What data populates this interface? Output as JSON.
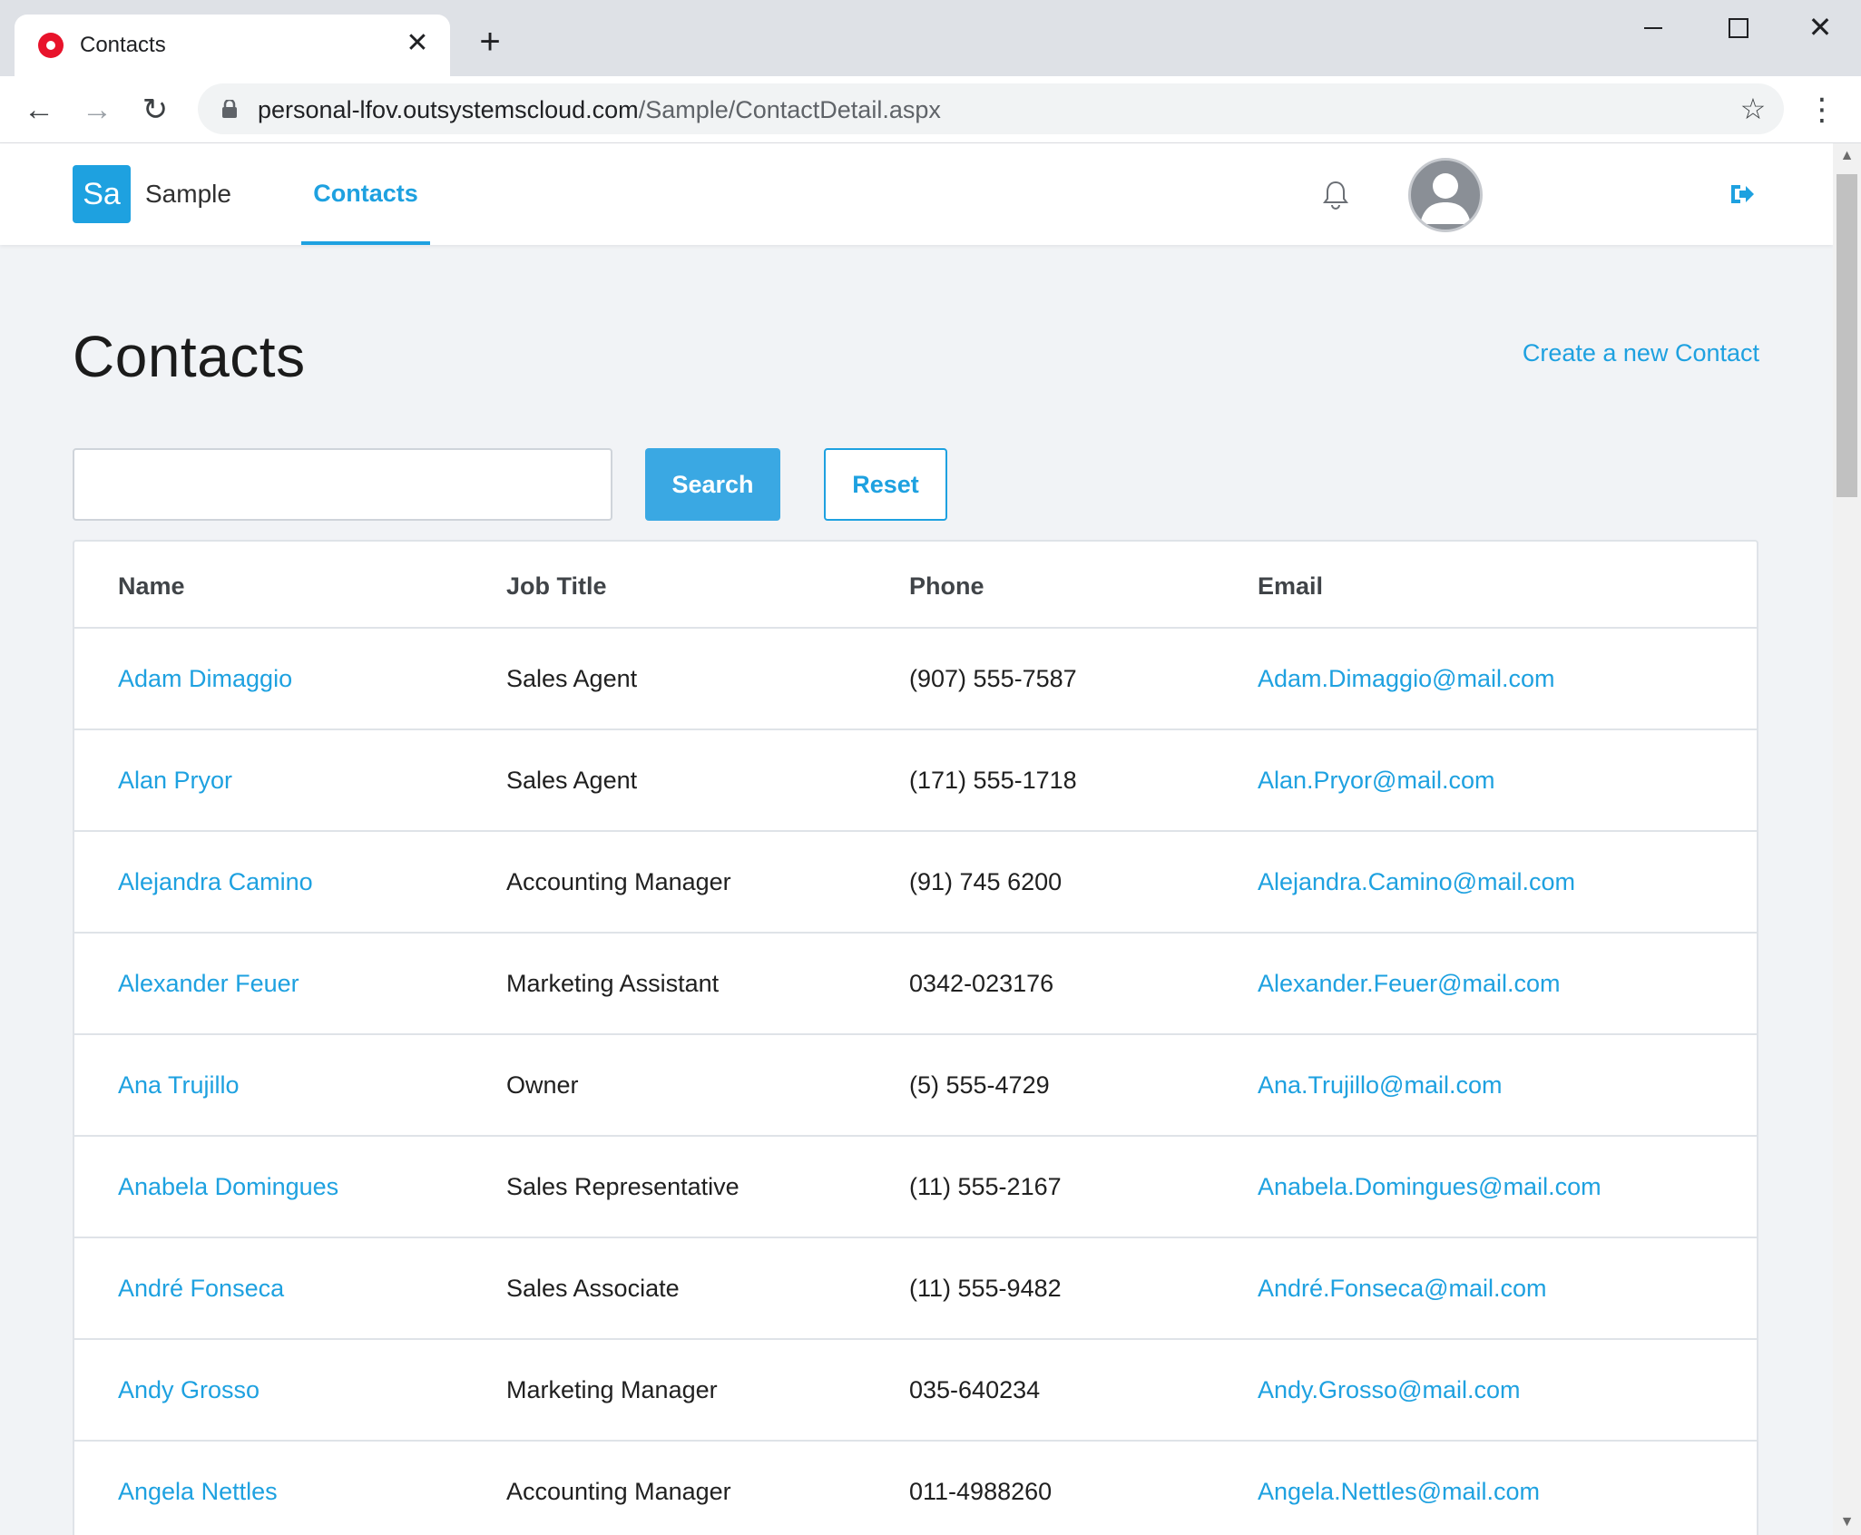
{
  "browser": {
    "tab_title": "Contacts",
    "tab_close": "✕",
    "new_tab": "+",
    "url_host": "personal-lfov.outsystemscloud.com",
    "url_path": "/Sample/ContactDetail.aspx",
    "icons": {
      "favicon": "opera-red-circle",
      "back": "arrow-left-icon",
      "forward": "arrow-right-icon",
      "reload": "reload-icon",
      "lock": "lock-icon",
      "star": "star-icon",
      "menu": "kebab-menu-icon"
    }
  },
  "app": {
    "logo_text": "Sa",
    "name": "Sample",
    "nav_active": "Contacts",
    "accent_color": "#1ea1e0"
  },
  "page": {
    "title": "Contacts",
    "create_link": "Create a new Contact",
    "search_placeholder": "",
    "search_button": "Search",
    "reset_button": "Reset"
  },
  "table": {
    "headers": [
      "Name",
      "Job Title",
      "Phone",
      "Email"
    ],
    "rows": [
      {
        "name": "Adam Dimaggio",
        "job": "Sales Agent",
        "phone": "(907) 555-7587",
        "email": "Adam.Dimaggio@mail.com"
      },
      {
        "name": "Alan Pryor",
        "job": "Sales Agent",
        "phone": "(171) 555-1718",
        "email": "Alan.Pryor@mail.com"
      },
      {
        "name": "Alejandra Camino",
        "job": "Accounting Manager",
        "phone": "(91) 745 6200",
        "email": "Alejandra.Camino@mail.com"
      },
      {
        "name": "Alexander Feuer",
        "job": "Marketing Assistant",
        "phone": "0342-023176",
        "email": "Alexander.Feuer@mail.com"
      },
      {
        "name": "Ana Trujillo",
        "job": "Owner",
        "phone": "(5) 555-4729",
        "email": "Ana.Trujillo@mail.com"
      },
      {
        "name": "Anabela Domingues",
        "job": "Sales Representative",
        "phone": "(11) 555-2167",
        "email": "Anabela.Domingues@mail.com"
      },
      {
        "name": "André Fonseca",
        "job": "Sales Associate",
        "phone": "(11) 555-9482",
        "email": "André.Fonseca@mail.com"
      },
      {
        "name": "Andy Grosso",
        "job": "Marketing Manager",
        "phone": "035-640234",
        "email": "Andy.Grosso@mail.com"
      },
      {
        "name": "Angela Nettles",
        "job": "Accounting Manager",
        "phone": "011-4988260",
        "email": "Angela.Nettles@mail.com"
      }
    ]
  }
}
